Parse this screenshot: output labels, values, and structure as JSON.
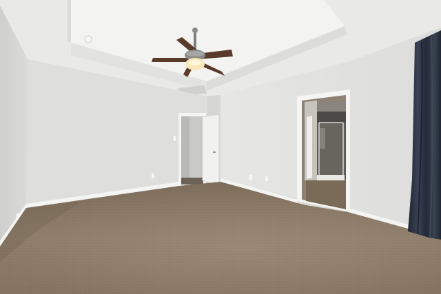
{
  "scene": {
    "room_type": "empty bedroom",
    "elements": [
      "ceiling-fan",
      "tray-ceiling",
      "doorway",
      "open-door",
      "bathroom-doorway",
      "glass-shower",
      "curtain",
      "carpet",
      "baseboard",
      "outlet"
    ]
  },
  "colors": {
    "ceiling": "#ececea",
    "tray": "#f2f2f0",
    "wall_back": "#dededc",
    "wall_left": "#d4d4d2",
    "wall_right": "#e2e2e0",
    "trim": "#f4f4f2",
    "carpet": "#8c7b68",
    "carpet_dark": "#6f604f",
    "curtain": "#2c3342",
    "fan_blade": "#5a3a2a",
    "fan_body": "#8a8a88",
    "light": "#f6e6b8",
    "bath_floor": "#7a6a58",
    "tile": "#5c5a56"
  }
}
